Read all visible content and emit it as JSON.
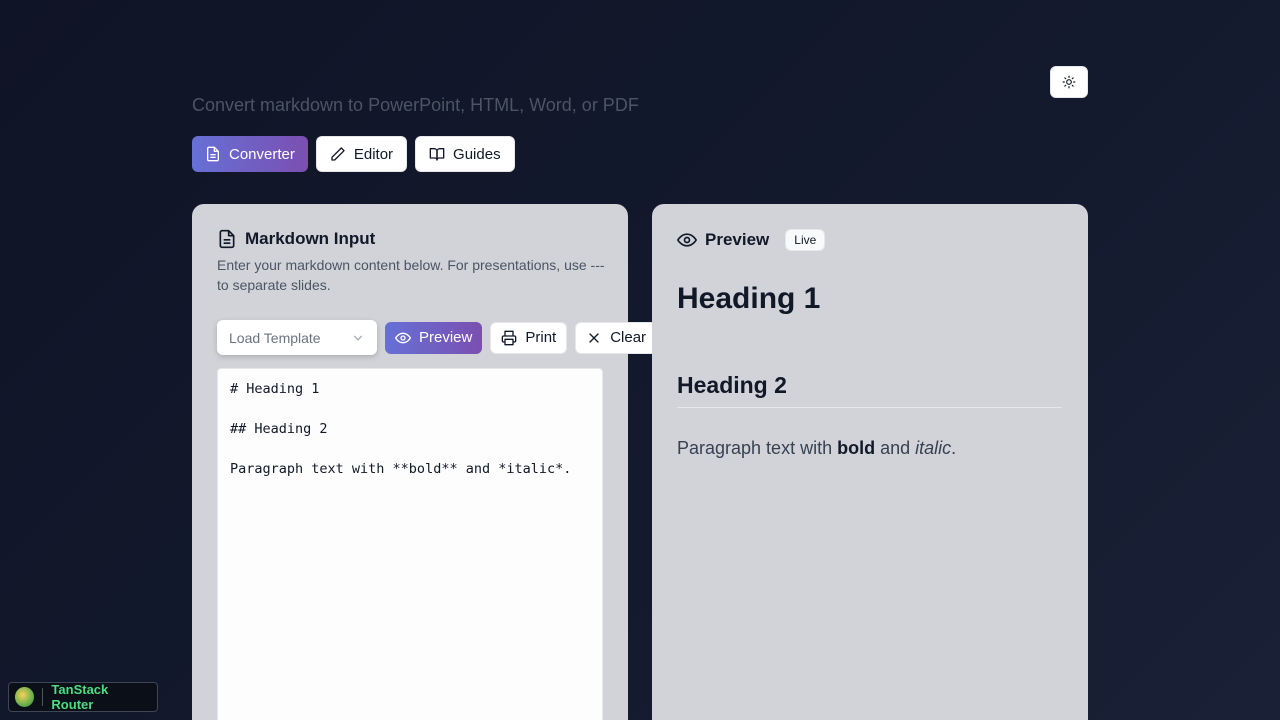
{
  "header": {
    "subtitle": "Convert markdown to PowerPoint, HTML, Word, or PDF",
    "theme_icon": "sun-icon"
  },
  "nav": {
    "tabs": [
      {
        "label": "Converter",
        "icon": "file-text-icon",
        "active": true
      },
      {
        "label": "Editor",
        "icon": "pencil-icon",
        "active": false
      },
      {
        "label": "Guides",
        "icon": "book-open-icon",
        "active": false
      }
    ]
  },
  "input_panel": {
    "title": "Markdown Input",
    "description": "Enter your markdown content below. For presentations, use --- to separate slides.",
    "template_select": {
      "placeholder": "Load Template"
    },
    "buttons": {
      "preview": "Preview",
      "print": "Print",
      "clear": "Clear"
    },
    "editor_value": "# Heading 1\n\n## Heading 2\n\nParagraph text with **bold** and *italic*."
  },
  "preview_panel": {
    "title": "Preview",
    "badge": "Live",
    "h1": "Heading 1",
    "h2": "Heading 2",
    "paragraph": {
      "before": "Paragraph text with ",
      "bold": "bold",
      "middle": " and ",
      "italic": "italic",
      "after": "."
    }
  },
  "devtools": {
    "label": "TanStack Router"
  },
  "colors": {
    "accent_start": "#6670d6",
    "accent_end": "#7b4fb0",
    "background": "#0f1426",
    "panel": "#d1d3d9"
  }
}
